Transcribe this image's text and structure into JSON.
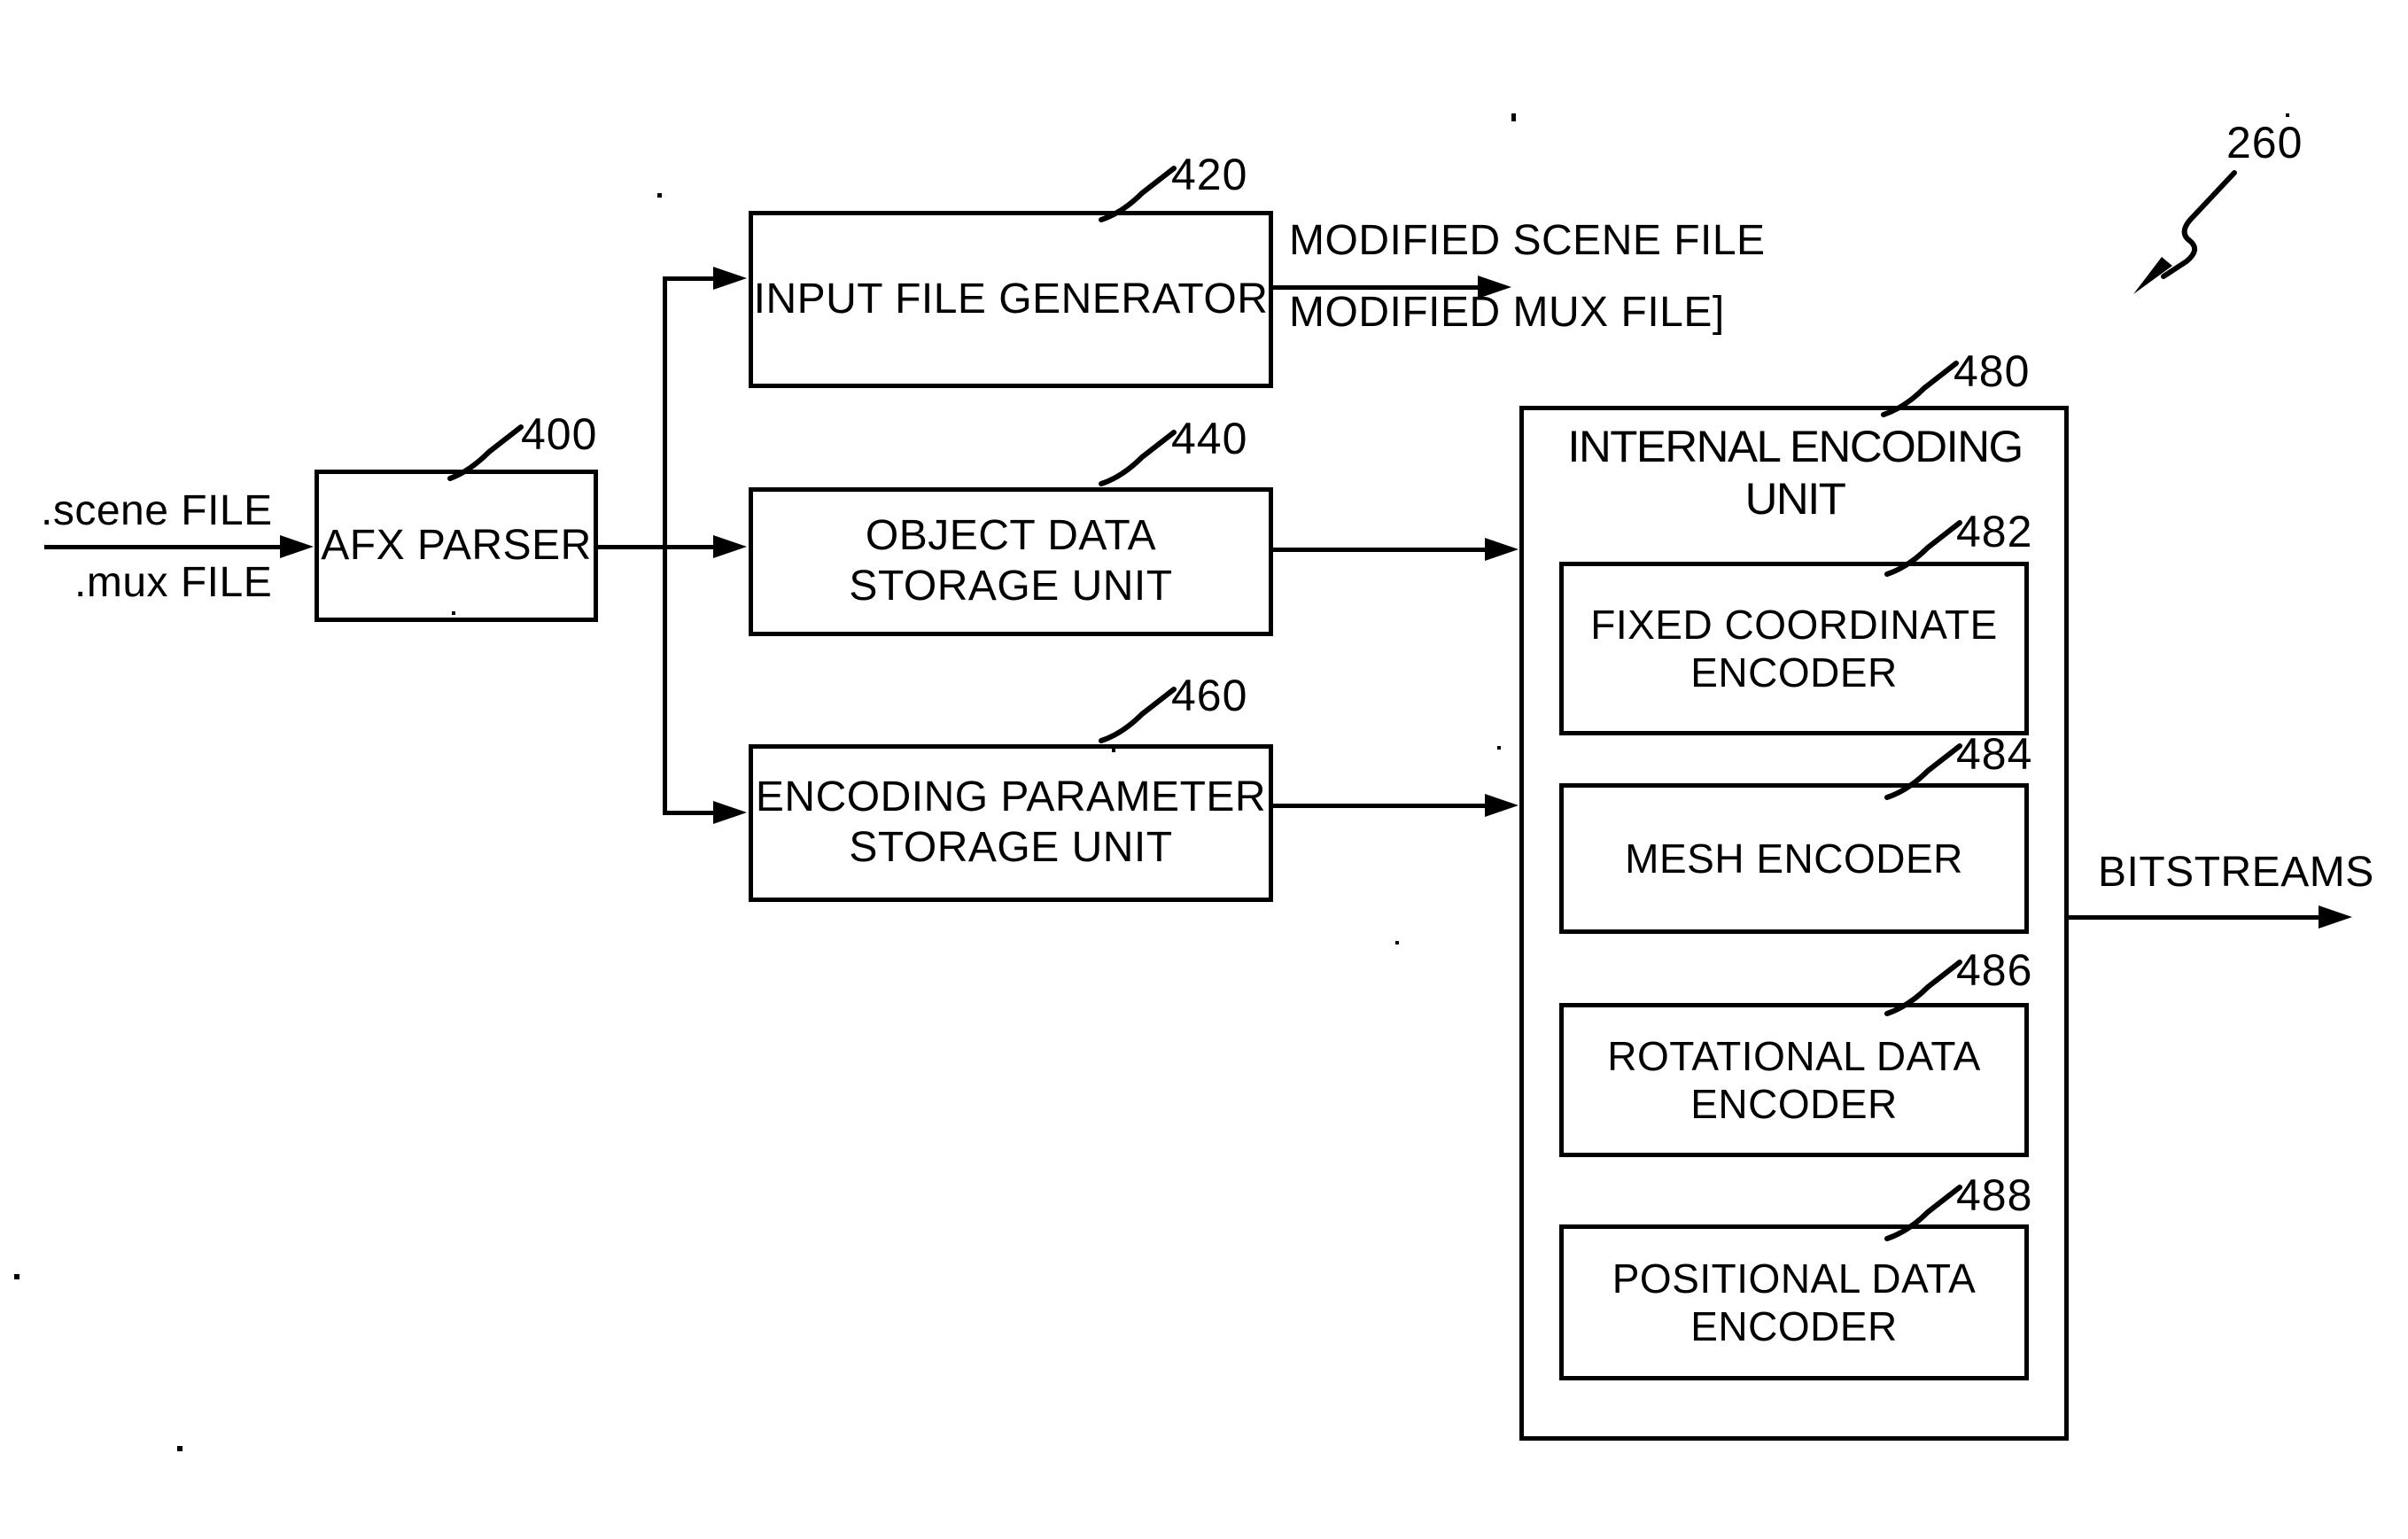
{
  "figure": {
    "number": "260",
    "type": "patent-block-diagram"
  },
  "inputs": {
    "scene_file": ".scene FILE",
    "mux_file": ".mux FILE"
  },
  "outputs": {
    "modified_scene_file": "MODIFIED SCENE FILE",
    "modified_mux_file": "MODIFIED MUX FILE]",
    "bitstreams": "BITSTREAMS"
  },
  "blocks": {
    "afx_parser": {
      "label": "AFX PARSER",
      "ref": "400"
    },
    "input_file_generator": {
      "label": "INPUT FILE GENERATOR",
      "ref": "420"
    },
    "object_data_storage_unit": {
      "label": "OBJECT DATA\nSTORAGE UNIT",
      "ref": "440"
    },
    "encoding_parameter_storage_unit": {
      "label": "ENCODING PARAMETER\nSTORAGE UNIT",
      "ref": "460"
    },
    "internal_encoding_unit": {
      "label": "INTERNAL ENCODING UNIT",
      "ref": "480"
    },
    "fixed_coordinate_encoder": {
      "label": "FIXED COORDINATE\nENCODER",
      "ref": "482"
    },
    "mesh_encoder": {
      "label": "MESH ENCODER",
      "ref": "484"
    },
    "rotational_data_encoder": {
      "label": "ROTATIONAL DATA\nENCODER",
      "ref": "486"
    },
    "positional_data_encoder": {
      "label": "POSITIONAL DATA\nENCODER",
      "ref": "488"
    }
  },
  "colors": {
    "ink": "#000000",
    "paper": "#ffffff"
  }
}
